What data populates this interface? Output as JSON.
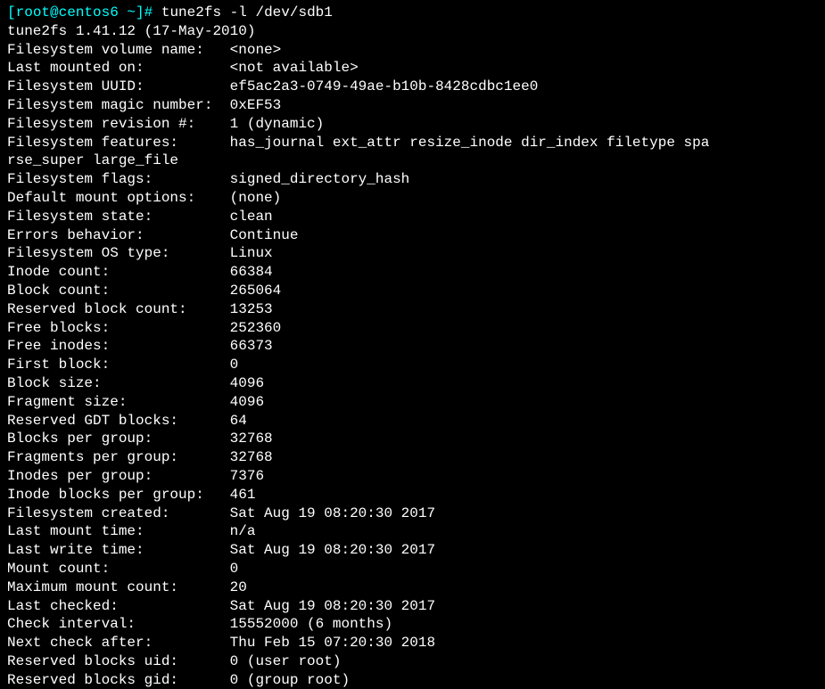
{
  "prompt": {
    "open_bracket": "[",
    "user_host": "root@centos6 ~",
    "close_bracket": "]",
    "hash": "# ",
    "command": "tune2fs -l /dev/sdb1"
  },
  "version_line": "tune2fs 1.41.12 (17-May-2010)",
  "fields": [
    {
      "label": "Filesystem volume name:   ",
      "value": "<none>"
    },
    {
      "label": "Last mounted on:          ",
      "value": "<not available>"
    },
    {
      "label": "Filesystem UUID:          ",
      "value": "ef5ac2a3-0749-49ae-b10b-8428cdbc1ee0"
    },
    {
      "label": "Filesystem magic number:  ",
      "value": "0xEF53"
    },
    {
      "label": "Filesystem revision #:    ",
      "value": "1 (dynamic)"
    },
    {
      "label": "Filesystem features:      ",
      "value": "has_journal ext_attr resize_inode dir_index filetype spa"
    }
  ],
  "features_wrap": "rse_super large_file",
  "fields2": [
    {
      "label": "Filesystem flags:         ",
      "value": "signed_directory_hash"
    },
    {
      "label": "Default mount options:    ",
      "value": "(none)"
    },
    {
      "label": "Filesystem state:         ",
      "value": "clean"
    },
    {
      "label": "Errors behavior:          ",
      "value": "Continue"
    },
    {
      "label": "Filesystem OS type:       ",
      "value": "Linux"
    },
    {
      "label": "Inode count:              ",
      "value": "66384"
    },
    {
      "label": "Block count:              ",
      "value": "265064"
    },
    {
      "label": "Reserved block count:     ",
      "value": "13253"
    },
    {
      "label": "Free blocks:              ",
      "value": "252360"
    },
    {
      "label": "Free inodes:              ",
      "value": "66373"
    },
    {
      "label": "First block:              ",
      "value": "0"
    },
    {
      "label": "Block size:               ",
      "value": "4096"
    },
    {
      "label": "Fragment size:            ",
      "value": "4096"
    },
    {
      "label": "Reserved GDT blocks:      ",
      "value": "64"
    },
    {
      "label": "Blocks per group:         ",
      "value": "32768"
    },
    {
      "label": "Fragments per group:      ",
      "value": "32768"
    },
    {
      "label": "Inodes per group:         ",
      "value": "7376"
    },
    {
      "label": "Inode blocks per group:   ",
      "value": "461"
    },
    {
      "label": "Filesystem created:       ",
      "value": "Sat Aug 19 08:20:30 2017"
    },
    {
      "label": "Last mount time:          ",
      "value": "n/a"
    },
    {
      "label": "Last write time:          ",
      "value": "Sat Aug 19 08:20:30 2017"
    },
    {
      "label": "Mount count:              ",
      "value": "0"
    },
    {
      "label": "Maximum mount count:      ",
      "value": "20"
    },
    {
      "label": "Last checked:             ",
      "value": "Sat Aug 19 08:20:30 2017"
    },
    {
      "label": "Check interval:           ",
      "value": "15552000 (6 months)"
    },
    {
      "label": "Next check after:         ",
      "value": "Thu Feb 15 07:20:30 2018"
    },
    {
      "label": "Reserved blocks uid:      ",
      "value": "0 (user root)"
    },
    {
      "label": "Reserved blocks gid:      ",
      "value": "0 (group root)"
    }
  ]
}
